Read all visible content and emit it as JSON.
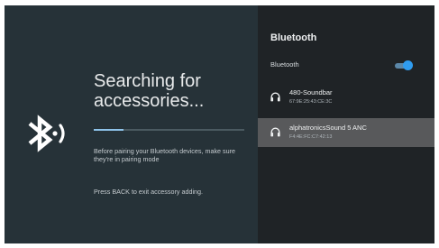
{
  "left": {
    "title": "Searching for accessories...",
    "progress_fraction": 0.2,
    "pairing_note": "Before pairing your Bluetooth devices, make sure they're in pairing mode",
    "exit_note": "Press BACK to exit accessory adding.",
    "icon": "bluetooth-searching-icon"
  },
  "panel": {
    "title": "Bluetooth",
    "toggle": {
      "label": "Bluetooth",
      "on": true,
      "color": "#2f9cf0"
    },
    "devices": [
      {
        "name": "480-Soundbar",
        "address": "67:9E:25:43:CE:3C",
        "icon": "headphones-icon",
        "selected": false
      },
      {
        "name": "alphatronicsSound 5 ANC",
        "address": "F4:4E:FC:C7:42:13",
        "icon": "headphones-icon",
        "selected": true
      }
    ]
  },
  "colors": {
    "background": "#263238",
    "panel": "#1f2326",
    "selected_row": "#58595b",
    "accent": "#2f9cf0"
  }
}
